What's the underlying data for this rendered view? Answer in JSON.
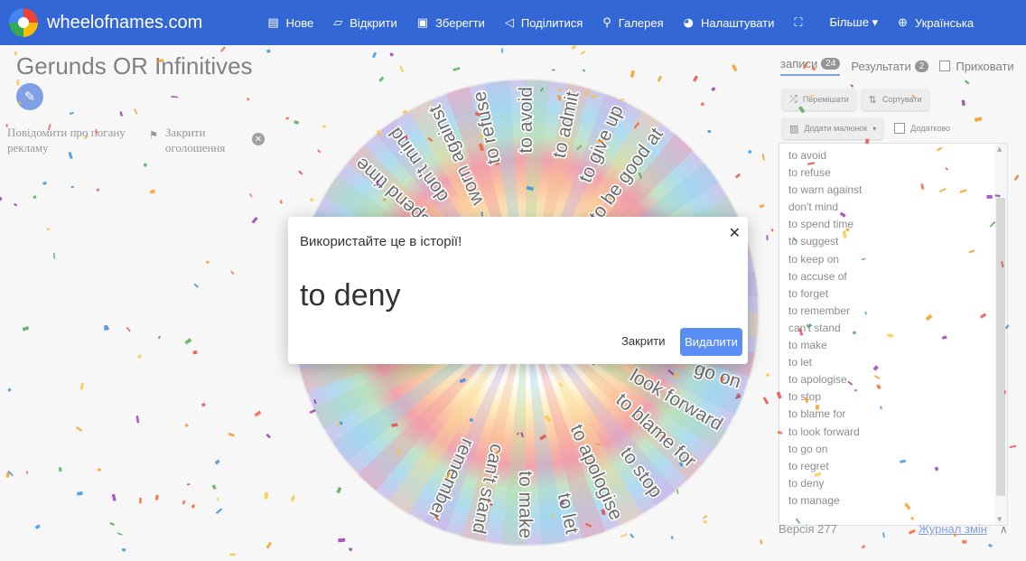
{
  "app": {
    "brand": "wheelofnames.com",
    "accent": "#3367d6"
  },
  "nav": [
    {
      "icon": "file-icon",
      "glyph": "▤",
      "label": "Нове"
    },
    {
      "icon": "folder-open-icon",
      "glyph": "▱",
      "label": "Відкрити"
    },
    {
      "icon": "floppy-disk-icon",
      "glyph": "▣",
      "label": "Зберегти"
    },
    {
      "icon": "share-icon",
      "glyph": "◁",
      "label": "Поділитися"
    },
    {
      "icon": "search-icon",
      "glyph": "⚲",
      "label": "Галерея"
    },
    {
      "icon": "palette-icon",
      "glyph": "◕",
      "label": "Налаштувати"
    },
    {
      "icon": "fullscreen-icon",
      "glyph": "⛶",
      "label": ""
    },
    {
      "icon": "caret-down-icon",
      "glyph": "",
      "label": "Більше ▾"
    },
    {
      "icon": "globe-icon",
      "glyph": "⊕",
      "label": "Українська"
    }
  ],
  "page": {
    "title": "Gerunds OR Infinitives",
    "ad_report": "Повідомити про погану рекламу",
    "ad_close": "Закрити оголошення"
  },
  "wheel": {
    "labels": [
      "to avoid",
      "to admit",
      "to give up",
      "to be good at",
      "",
      "",
      "",
      "",
      "",
      "go on",
      "look forward",
      "to blame for",
      "to stop",
      "to apologise",
      "to let",
      "to make",
      "can't stand",
      "remember",
      "",
      "",
      "",
      "",
      "",
      "",
      "",
      "",
      "to spend time",
      "don't mind",
      "worn against",
      "to refuse"
    ]
  },
  "panel": {
    "tabs": {
      "entries_label": "записи",
      "entries_count": "24",
      "results_label": "Результати",
      "results_count": "2",
      "hide_label": "Приховати"
    },
    "tools": {
      "shuffle": "Перемішати",
      "sort": "Сортувати",
      "add_image": "Додати малюнок",
      "advanced": "Додатково"
    },
    "entries": [
      "to avoid",
      "to refuse",
      "to warn against",
      "don't mind",
      "to spend time",
      "to suggest",
      "to keep on",
      "to accuse of",
      "to forget",
      "to remember",
      "can't stand",
      "to make",
      "to let",
      "to apologise",
      "to stop",
      "to blame for",
      "to look forward",
      "to go on",
      "to regret",
      "to deny",
      "to manage"
    ],
    "version": "Версія 277",
    "changelog": "Журнал змін"
  },
  "dialog": {
    "title": "Використайте це в історії!",
    "result": "to deny",
    "close_label": "Закрити",
    "delete_label": "Видалити"
  }
}
